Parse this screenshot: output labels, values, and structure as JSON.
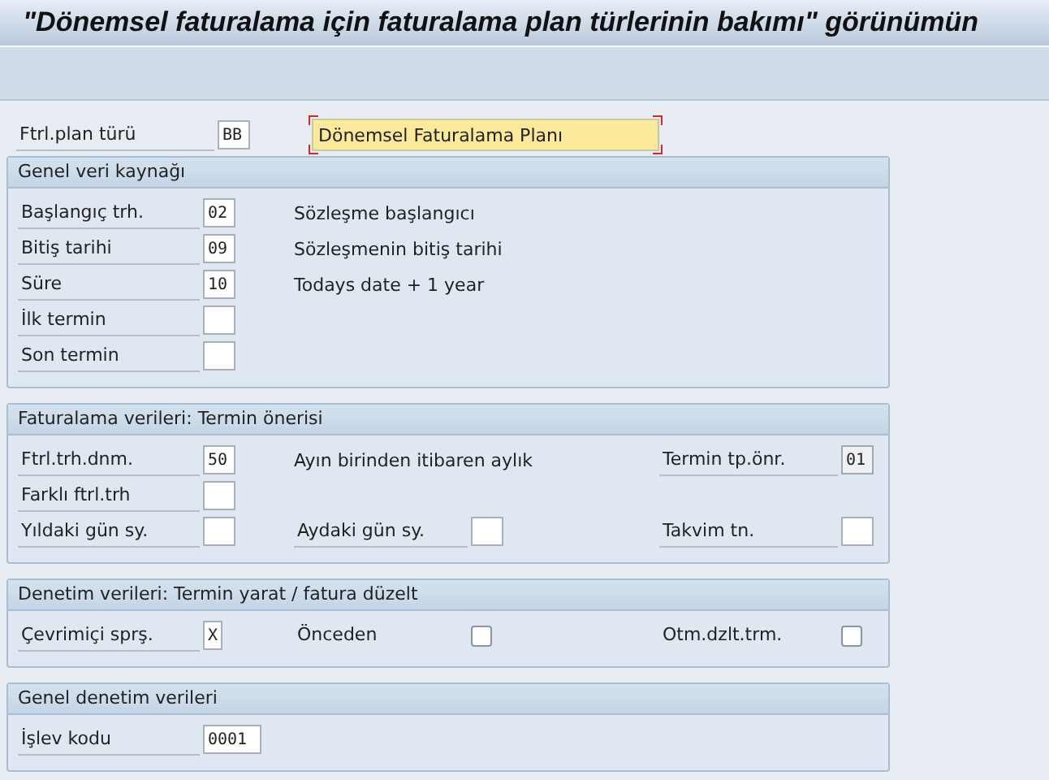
{
  "window": {
    "title": "\"Dönemsel faturalama için faturalama plan türlerinin bakımı\" görünümün"
  },
  "header": {
    "label": "Ftrl.plan türü",
    "value": "BB",
    "description": "Dönemsel Faturalama Planı",
    "description_focused": true
  },
  "sections": [
    {
      "title": "Genel veri kaynağı",
      "rows": [
        [
          {
            "kind": "input",
            "label": "Başlangıç trh.",
            "value": "02",
            "disabled": false
          },
          {
            "kind": "note",
            "text": "Sözleşme başlangıcı"
          }
        ],
        [
          {
            "kind": "input",
            "label": "Bitiş tarihi",
            "value": "09",
            "disabled": false
          },
          {
            "kind": "note",
            "text": "Sözleşmenin bitiş tarihi"
          }
        ],
        [
          {
            "kind": "input",
            "label": "Süre",
            "value": "10",
            "disabled": false
          },
          {
            "kind": "note",
            "text": "Todays date + 1 year"
          }
        ],
        [
          {
            "kind": "input",
            "label": "İlk termin",
            "disabled": false
          }
        ],
        [
          {
            "kind": "input",
            "label": "Son termin",
            "disabled": false
          }
        ]
      ]
    },
    {
      "title": "Faturalama verileri: Termin önerisi",
      "rows": [
        [
          {
            "kind": "input",
            "label": "Ftrl.trh.dnm.",
            "value": "50",
            "disabled": false
          },
          {
            "kind": "note",
            "text": "Ayın birinden itibaren aylık"
          },
          {
            "kind": "input",
            "label": "Termin tp.önr.",
            "value": "01",
            "disabled": true
          }
        ],
        [
          {
            "kind": "input",
            "label": "Farklı ftrl.trh",
            "disabled": false
          }
        ],
        [
          {
            "kind": "input",
            "label": "Yıldaki gün sy.",
            "disabled": false
          },
          {
            "kind": "input",
            "label": "Aydaki gün sy.",
            "disabled": false
          },
          {
            "kind": "input",
            "label": "Takvim tn.",
            "disabled": false
          }
        ]
      ]
    },
    {
      "title": "Denetim verileri: Termin yarat / fatura düzelt",
      "rows": [
        [
          {
            "kind": "input",
            "label": "Çevrimiçi sprş.",
            "value": "X",
            "disabled": false
          },
          {
            "kind": "checkbox",
            "label": "Önceden",
            "checked": false
          },
          {
            "kind": "checkbox",
            "label": "Otm.dzlt.trm.",
            "checked": false
          }
        ]
      ]
    },
    {
      "title": "Genel denetim verileri",
      "rows": [
        [
          {
            "kind": "input",
            "label": "İşlev kodu",
            "value": "0001",
            "disabled": false
          }
        ]
      ]
    }
  ]
}
